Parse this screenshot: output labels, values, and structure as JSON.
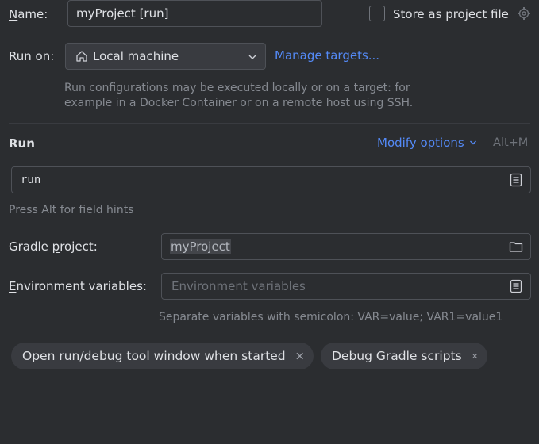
{
  "name": {
    "mnemonic": "N",
    "rest": "ame:",
    "value": "myProject [run]"
  },
  "store_as_project_file": {
    "label": "Store as project file",
    "checked": false
  },
  "run_on": {
    "label": "Run on:",
    "value": "Local machine",
    "manage_link": "Manage targets...",
    "hint_line1": "Run configurations may be executed locally or on a target: for",
    "hint_line2": "example in a Docker Container or on a remote host using SSH."
  },
  "run_section": {
    "title": "Run",
    "modify_options": "Modify options",
    "shortcut": "Alt+M",
    "command_value": "run",
    "field_hint": "Press Alt for field hints"
  },
  "gradle_project": {
    "pre": "Gradle ",
    "mnemonic": "p",
    "post": "roject:",
    "value": "myProject"
  },
  "env_vars": {
    "mnemonic": "E",
    "rest": "nvironment variables:",
    "placeholder": "Environment variables",
    "hint": "Separate variables with semicolon: VAR=value; VAR1=value1"
  },
  "chips": [
    {
      "label": "Open run/debug tool window when started"
    },
    {
      "label": "Debug Gradle scripts"
    }
  ],
  "colors": {
    "background": "#2b2d30",
    "link": "#548af7",
    "border": "#4e5157",
    "chip": "#393b40"
  }
}
